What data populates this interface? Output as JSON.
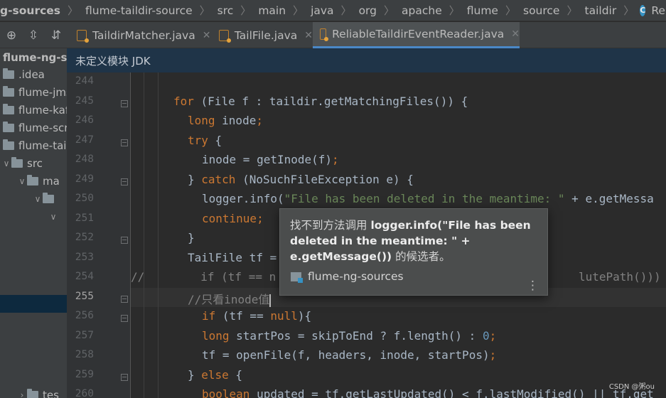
{
  "breadcrumb": [
    "g-sources",
    "flume-taildir-source",
    "src",
    "main",
    "java",
    "org",
    "apache",
    "flume",
    "source",
    "taildir",
    "ReliableTaildirEventReader"
  ],
  "tabs": [
    {
      "label": "TaildirMatcher.java"
    },
    {
      "label": "TailFile.java"
    },
    {
      "label": "ReliableTaildirEventReader.java"
    }
  ],
  "sidebar": {
    "root": "flume-ng-so",
    "items": [
      ".idea",
      "flume-jms",
      "flume-kaf",
      "flume-scr",
      "flume-tail",
      "src",
      "ma",
      "tes"
    ]
  },
  "notice": "未定义模块 JDK",
  "line_numbers": [
    "244",
    "245",
    "246",
    "247",
    "248",
    "249",
    "250",
    "251",
    "252",
    "253",
    "254",
    "255",
    "256",
    "257",
    "258",
    "259",
    "260"
  ],
  "code": {
    "l245_kw": "for",
    "l245_rest": " (File f : taildir.getMatchingFiles()) {",
    "l246_kw": "long",
    "l246_rest": " inode",
    "l247_kw": "try",
    "l247_rest": " {",
    "l248_a": "inode = ",
    "l248_fn": "getInode",
    "l248_b": "(f)",
    "l249_a": "} ",
    "l249_kw": "catch",
    "l249_b": " (NoSuchFileException e) {",
    "l250_a": "logger.info(",
    "l250_str": "\"File has been deleted in the meantime: \"",
    "l250_b": " + e.getMessa",
    "l251_kw": "continue",
    "l252": "}",
    "l253": "TailFile tf = ",
    "l254_comment": "//",
    "l254_kw": "if",
    "l254_a": " (tf == n",
    "l254_b": "lutePath())) {",
    "l255": "//只看inode值",
    "l256_kw": "if",
    "l256_a": " (tf == ",
    "l256_null": "null",
    "l256_b": "){",
    "l257_kw": "long",
    "l257_a": " startPos = skipToEnd ? f.length() : ",
    "l257_num": "0",
    "l258_a": "tf = ",
    "l258_fn": "openFile",
    "l258_b": "(f, headers, inode, startPos)",
    "l259_a": "} ",
    "l259_kw": "else",
    "l259_b": " {",
    "l260_kw": "boolean",
    "l260_a": " updated = tf.getLastUpdated() < f.lastModified() || tf.get"
  },
  "popup": {
    "prefix": "找不到方法调用 ",
    "bold": "logger.info(\"File has been deleted in the meantime: \" + e.getMessage())",
    "suffix": " 的候选者。",
    "module": "flume-ng-sources"
  },
  "watermark": "CSDN @粥ou",
  "colors": {
    "keyword": "#cc7832",
    "string": "#6a8759",
    "number": "#6897bb",
    "function": "#ffc66d",
    "comment": "#808080"
  }
}
